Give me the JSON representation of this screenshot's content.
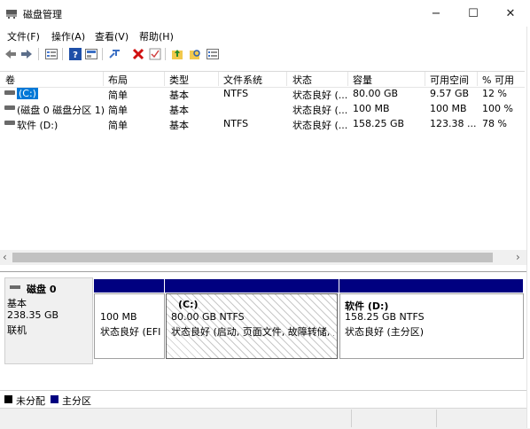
{
  "window": {
    "title": "磁盘管理",
    "minimize": "−",
    "maximize": "☐",
    "close": "✕"
  },
  "menu": [
    "文件(F)",
    "操作(A)",
    "查看(V)",
    "帮助(H)"
  ],
  "toolbar": {
    "icons": [
      "back-arrow-icon",
      "forward-arrow-icon",
      "list-view-icon",
      "help-icon",
      "properties-icon",
      "connect-disk-icon",
      "delete-icon",
      "check-icon",
      "folder-up-icon",
      "search-folder-icon",
      "console-icon"
    ]
  },
  "volumes": {
    "columns": [
      "卷",
      "布局",
      "类型",
      "文件系统",
      "状态",
      "容量",
      "可用空间",
      "% 可用"
    ],
    "rows": [
      {
        "volume": "(C:)",
        "layout": "简单",
        "type": "基本",
        "fs": "NTFS",
        "status": "状态良好 (...",
        "capacity": "80.00 GB",
        "free": "9.57 GB",
        "pct": "12 %"
      },
      {
        "volume": "(磁盘 0 磁盘分区 1)",
        "layout": "简单",
        "type": "基本",
        "fs": "",
        "status": "状态良好 (...",
        "capacity": "100 MB",
        "free": "100 MB",
        "pct": "100 %"
      },
      {
        "volume": "软件 (D:)",
        "layout": "简单",
        "type": "基本",
        "fs": "NTFS",
        "status": "状态良好 (...",
        "capacity": "158.25 GB",
        "free": "123.38 ...",
        "pct": "78 %"
      }
    ]
  },
  "scroll": {
    "left": "‹",
    "right": "›"
  },
  "disk": {
    "name": "磁盘 0",
    "type": "基本",
    "size": "238.35 GB",
    "state": "联机",
    "partitions": [
      {
        "title": "",
        "size": "100 MB",
        "status": "状态良好 (EFI"
      },
      {
        "title": "(C:)",
        "size": "80.00 GB NTFS",
        "status": "状态良好 (启动, 页面文件, 故障转储, 主"
      },
      {
        "title": "软件  (D:)",
        "size": "158.25 GB NTFS",
        "status": "状态良好 (主分区)"
      }
    ]
  },
  "legend": {
    "unallocated": "未分配",
    "primary": "主分区"
  },
  "colors": {
    "primary_partition": "#000080",
    "unallocated": "#000000",
    "selection": "#0078d7"
  }
}
